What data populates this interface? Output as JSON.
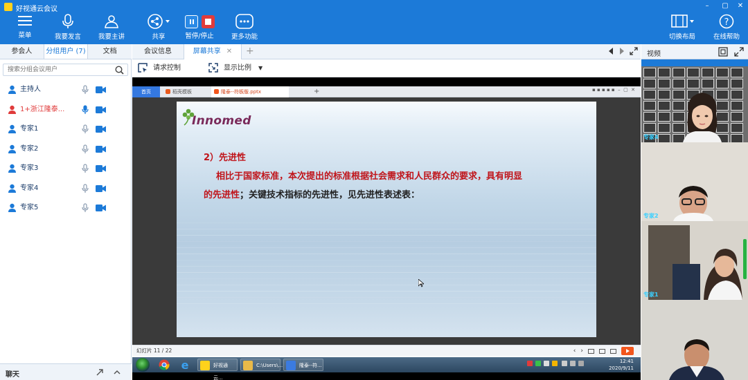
{
  "app": {
    "title": "好视通云会议",
    "window_controls": [
      "–",
      "▢",
      "✕"
    ]
  },
  "toolbar": {
    "items": [
      {
        "label": "菜单",
        "icon": "menu-icon"
      },
      {
        "label": "我要发言",
        "icon": "microphone-icon"
      },
      {
        "label": "我要主讲",
        "icon": "presenter-icon"
      },
      {
        "label": "共享",
        "icon": "share-icon"
      },
      {
        "label": "暂停/停止",
        "icon": "pause-stop-icon"
      },
      {
        "label": "更多功能",
        "icon": "more-functions-icon"
      }
    ],
    "right_items": [
      {
        "label": "切换布局",
        "icon": "layout-icon"
      },
      {
        "label": "在线帮助",
        "icon": "help-icon"
      }
    ]
  },
  "left_panel": {
    "tabs": [
      "参会人",
      "分组用户 (7)",
      "文档"
    ],
    "active_tab": 1,
    "search_placeholder": "搜索分组会议用户",
    "users": [
      {
        "name": "主持人",
        "color": "#1c3d6a"
      },
      {
        "name": "1+浙江隆泰...",
        "color": "#e03b3b"
      },
      {
        "name": "专家1",
        "color": "#1c3d6a"
      },
      {
        "name": "专家2",
        "color": "#1c3d6a"
      },
      {
        "name": "专家3",
        "color": "#1c3d6a"
      },
      {
        "name": "专家4",
        "color": "#1c3d6a"
      },
      {
        "name": "专家5",
        "color": "#1c3d6a"
      }
    ],
    "chat_title": "聊天"
  },
  "center": {
    "tabs": [
      "会议信息",
      "屏幕共享"
    ],
    "active_tab": 1,
    "tools": [
      "请求控制",
      "显示比例"
    ]
  },
  "shared_screen": {
    "wps_tabs": {
      "home": "首页",
      "template": "稻壳模板",
      "file": "隆泰--符板版.pptx"
    },
    "slide": {
      "logo_text": "Innomed",
      "heading": "2）先进性",
      "para1": "相比于国家标准，本次提出的标准根据社会需求和人民群众的要求，具有明显",
      "para2_red": "的先进性",
      "para2_rest": "；关键技术指标的先进性，见先进性表述表："
    },
    "status": {
      "page": "幻灯片 11 / 22"
    },
    "taskbar": {
      "items": [
        "好视通云...",
        "C:\\Users\\...",
        "隆泰--符..."
      ],
      "time": "12:41",
      "date": "2020/9/11"
    }
  },
  "right_panel": {
    "title": "视频",
    "videos": [
      {
        "label": "专家4"
      },
      {
        "label": "专家2"
      },
      {
        "label": "专家1"
      },
      {
        "label": ""
      }
    ]
  },
  "colors": {
    "brand_blue": "#1c7ad8",
    "red": "#e03b3b",
    "slide_red": "#c0141a"
  }
}
